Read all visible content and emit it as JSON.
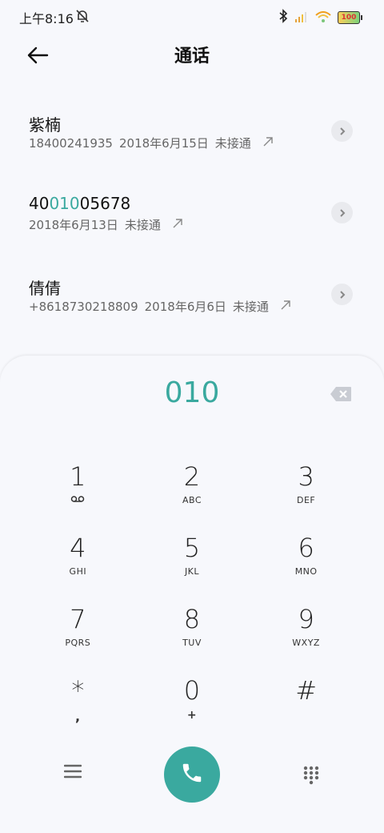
{
  "status_bar": {
    "time": "上午8:16",
    "battery": "100"
  },
  "header": {
    "title": "通话"
  },
  "calls": [
    {
      "name": "紫楠",
      "name_pre": "紫楠",
      "name_hl": "",
      "name_post": "",
      "number": "18400241935",
      "date": "2018年6月15日",
      "status": "未接通"
    },
    {
      "name": "4001005678",
      "name_pre": "40",
      "name_hl": "010",
      "name_post": "05678",
      "number": "",
      "date": "2018年6月13日",
      "status": "未接通"
    },
    {
      "name": "倩倩",
      "name_pre": "倩倩",
      "name_hl": "",
      "name_post": "",
      "number": "+8618730218809",
      "date": "2018年6月6日",
      "status": "未接通"
    }
  ],
  "dialer": {
    "input": "010",
    "keys": [
      {
        "digit": "1",
        "letters": ""
      },
      {
        "digit": "2",
        "letters": "ABC"
      },
      {
        "digit": "3",
        "letters": "DEF"
      },
      {
        "digit": "4",
        "letters": "GHI"
      },
      {
        "digit": "5",
        "letters": "JKL"
      },
      {
        "digit": "6",
        "letters": "MNO"
      },
      {
        "digit": "7",
        "letters": "PQRS"
      },
      {
        "digit": "8",
        "letters": "TUV"
      },
      {
        "digit": "9",
        "letters": "WXYZ"
      },
      {
        "digit": "*",
        "letters": ","
      },
      {
        "digit": "0",
        "letters": "+"
      },
      {
        "digit": "#",
        "letters": ""
      }
    ]
  },
  "colors": {
    "accent": "#3aa99f",
    "background": "#f7f8fc"
  },
  "icons": [
    "mute-bell-icon",
    "bluetooth-icon",
    "signal-icon",
    "wifi-icon",
    "battery-icon",
    "back-arrow-icon",
    "chevron-right-icon",
    "outgoing-call-icon",
    "backspace-icon",
    "voicemail-icon",
    "menu-icon",
    "phone-icon",
    "dialpad-icon"
  ]
}
